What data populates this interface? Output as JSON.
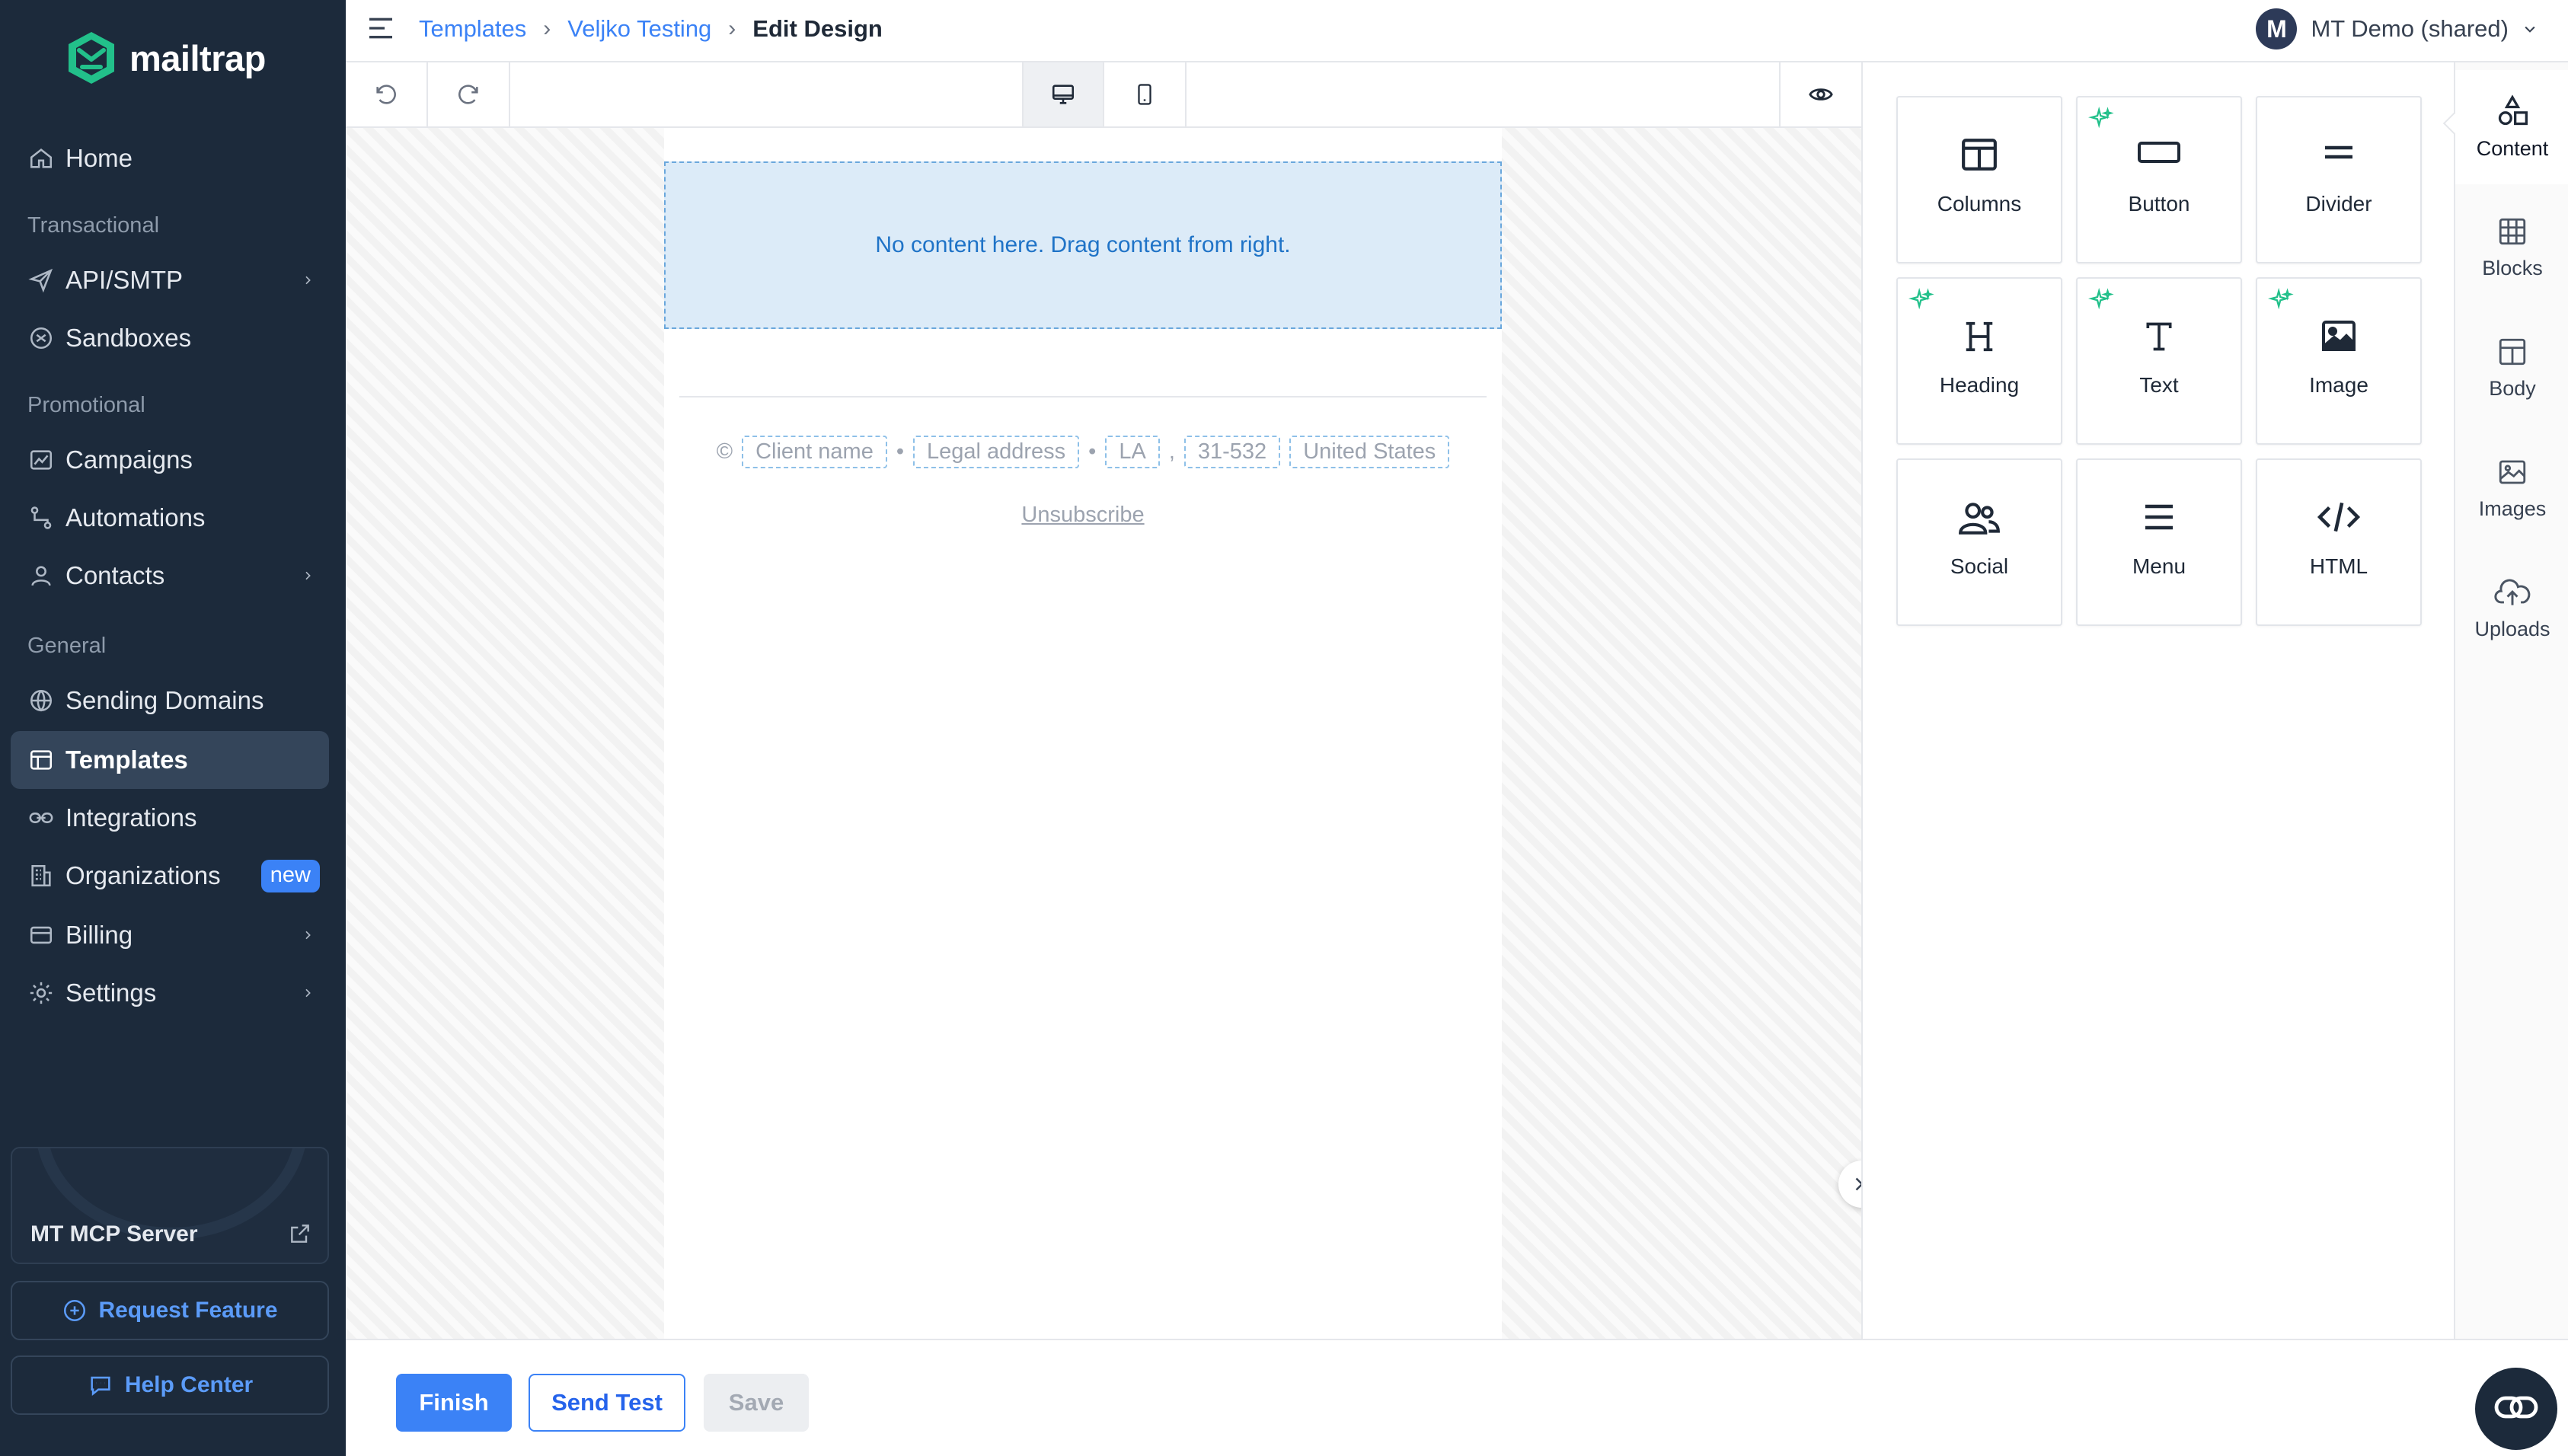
{
  "app": {
    "name": "mailtrap"
  },
  "sidebar": {
    "items": {
      "home": "Home",
      "api_smtp": "API/SMTP",
      "sandboxes": "Sandboxes",
      "campaigns": "Campaigns",
      "automations": "Automations",
      "contacts": "Contacts",
      "sending_domains": "Sending Domains",
      "templates": "Templates",
      "integrations": "Integrations",
      "organizations": "Organizations",
      "billing": "Billing",
      "settings": "Settings"
    },
    "sections": {
      "transactional": "Transactional",
      "promotional": "Promotional",
      "general": "General"
    },
    "badge_new": "new",
    "active_item": "Templates",
    "mcp_card_title": "MT MCP Server",
    "request_feature": "Request Feature",
    "help_center": "Help Center"
  },
  "header": {
    "breadcrumb": [
      "Templates",
      "Veljko Testing",
      "Edit Design"
    ],
    "separator": "›",
    "account_initial": "M",
    "account_name": "MT Demo (shared)"
  },
  "editor": {
    "view_mode": "desktop",
    "dropzone_text": "No content here. Drag content from right.",
    "footer": {
      "copyright": "©",
      "client_name": "Client name",
      "legal_address": "Legal address",
      "state": "LA",
      "zip": "31-532",
      "country": "United States",
      "bullet": "•",
      "comma": ",",
      "unsubscribe": "Unsubscribe"
    }
  },
  "panel": {
    "tools": {
      "columns": "Columns",
      "button": "Button",
      "divider": "Divider",
      "heading": "Heading",
      "text": "Text",
      "image": "Image",
      "social": "Social",
      "menu": "Menu",
      "html": "HTML"
    },
    "tabs": {
      "content": "Content",
      "blocks": "Blocks",
      "body": "Body",
      "images": "Images",
      "uploads": "Uploads"
    },
    "active_tab": "Content"
  },
  "bottombar": {
    "finish": "Finish",
    "send_test": "Send Test",
    "save": "Save"
  },
  "colors": {
    "sidebar_bg": "#1c2a3b",
    "accent": "#3b82f6",
    "brand_green": "#22c08a",
    "dropzone_bg": "#dcebf8"
  }
}
